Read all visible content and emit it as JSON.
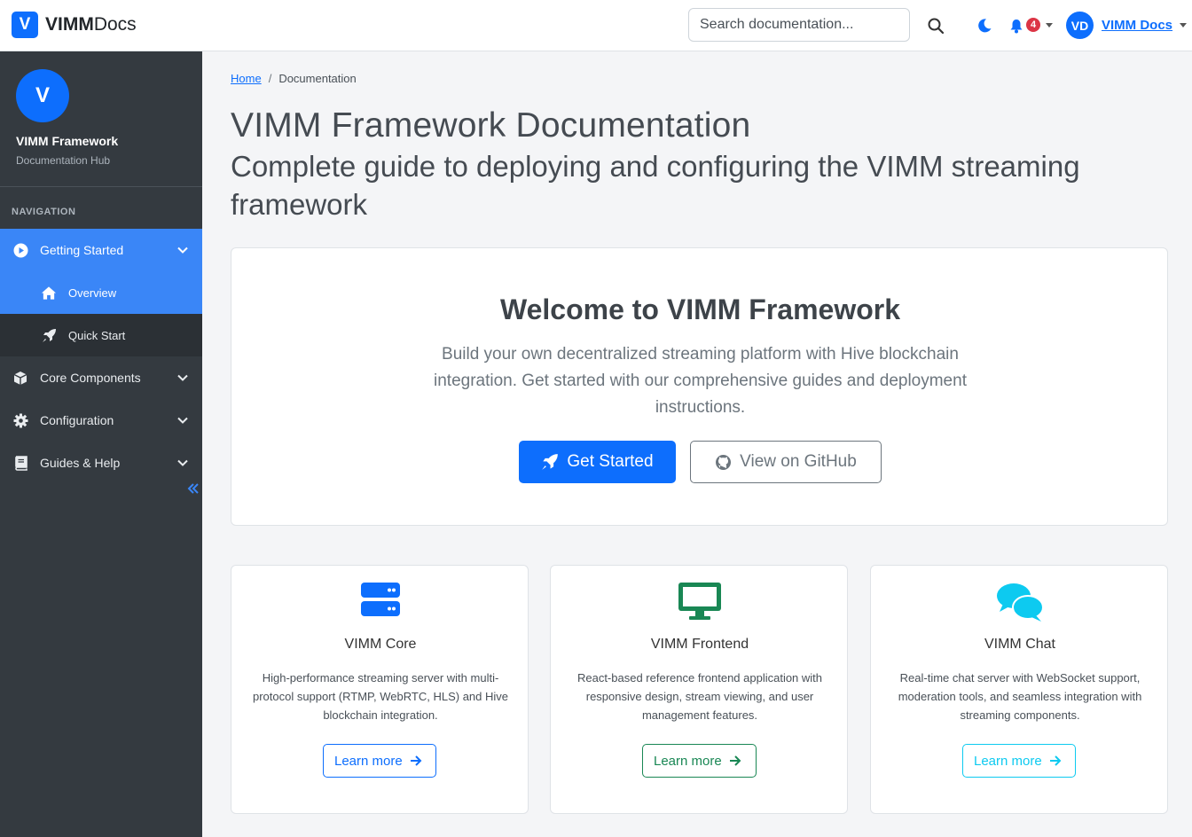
{
  "header": {
    "brand_logo_letter": "V",
    "brand_bold": "VIMM",
    "brand_light": "Docs",
    "search_placeholder": "Search documentation...",
    "notification_count": "4",
    "user_initials": "VD",
    "user_name": "VIMM Docs"
  },
  "sidebar": {
    "avatar_letter": "V",
    "title": "VIMM Framework",
    "subtitle": "Documentation Hub",
    "section_label": "NAVIGATION",
    "items": [
      {
        "label": "Getting Started",
        "icon": "play-circle-icon"
      },
      {
        "label": "Overview",
        "icon": "home-icon"
      },
      {
        "label": "Quick Start",
        "icon": "rocket-icon"
      },
      {
        "label": "Core Components",
        "icon": "cube-icon"
      },
      {
        "label": "Configuration",
        "icon": "gear-icon"
      },
      {
        "label": "Guides & Help",
        "icon": "book-icon"
      }
    ]
  },
  "breadcrumb": {
    "home": "Home",
    "separator": "/",
    "current": "Documentation"
  },
  "page": {
    "title": "VIMM Framework Documentation",
    "subtitle": "Complete guide to deploying and configuring the VIMM streaming framework"
  },
  "welcome": {
    "title": "Welcome to VIMM Framework",
    "text": "Build your own decentralized streaming platform with Hive blockchain integration. Get started with our comprehensive guides and deployment instructions.",
    "primary_button": "Get Started",
    "secondary_button": "View on GitHub"
  },
  "features": [
    {
      "title": "VIMM Core",
      "description": "High-performance streaming server with multi-protocol support (RTMP, WebRTC, HLS) and Hive blockchain integration.",
      "button": "Learn more",
      "color": "#0d6efd",
      "icon": "server-icon"
    },
    {
      "title": "VIMM Frontend",
      "description": "React-based reference frontend application with responsive design, stream viewing, and user management features.",
      "button": "Learn more",
      "color": "#198754",
      "icon": "desktop-icon"
    },
    {
      "title": "VIMM Chat",
      "description": "Real-time chat server with WebSocket support, moderation tools, and seamless integration with streaming components.",
      "button": "Learn more",
      "color": "#0dcaf0",
      "icon": "comments-icon"
    }
  ],
  "colors": {
    "primary": "#0d6efd",
    "sidebar_bg": "#343a40",
    "sidebar_active": "#3a86f7",
    "badge": "#dc3545"
  }
}
